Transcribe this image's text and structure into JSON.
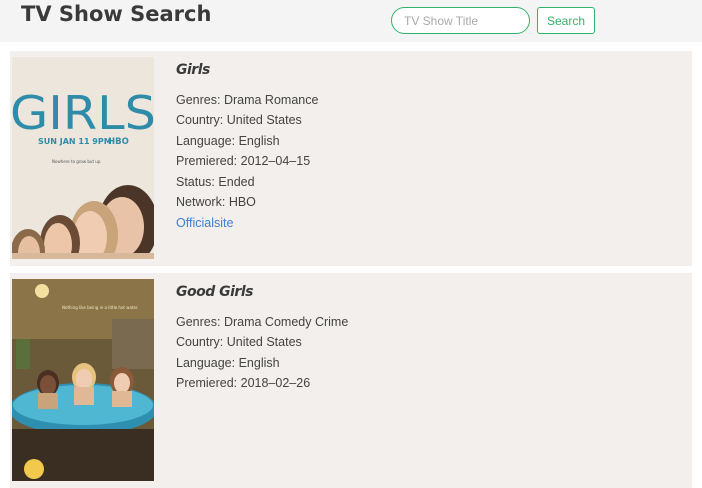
{
  "header": {
    "title": "TV Show Search",
    "search_placeholder": "TV Show Title",
    "search_value": "",
    "search_button": "Search"
  },
  "shows": [
    {
      "name": "Girls",
      "genres_label": "Genres:",
      "genres": "Drama Romance",
      "country_label": "Country:",
      "country": "United States",
      "language_label": "Language:",
      "language": "English",
      "premiered_label": "Premiered:",
      "premiered": "2012–04–15",
      "status_label": "Status:",
      "status": "Ended",
      "network_label": "Network:",
      "network": "HBO",
      "site_link": "Officialsite",
      "poster": {
        "title": "GIRLS",
        "date_line": "SUN JAN 11 9PM",
        "network_logo": "HBO",
        "tagline": "Nowhere to grow but up",
        "accent_color": "#2e8ca8"
      }
    },
    {
      "name": "Good Girls",
      "genres_label": "Genres:",
      "genres": "Drama Comedy Crime",
      "country_label": "Country:",
      "country": "United States",
      "language_label": "Language:",
      "language": "English",
      "premiered_label": "Premiered:",
      "premiered": "2018–02–26",
      "poster": {
        "tagline": "Nothing like being in a little hot water."
      }
    }
  ]
}
